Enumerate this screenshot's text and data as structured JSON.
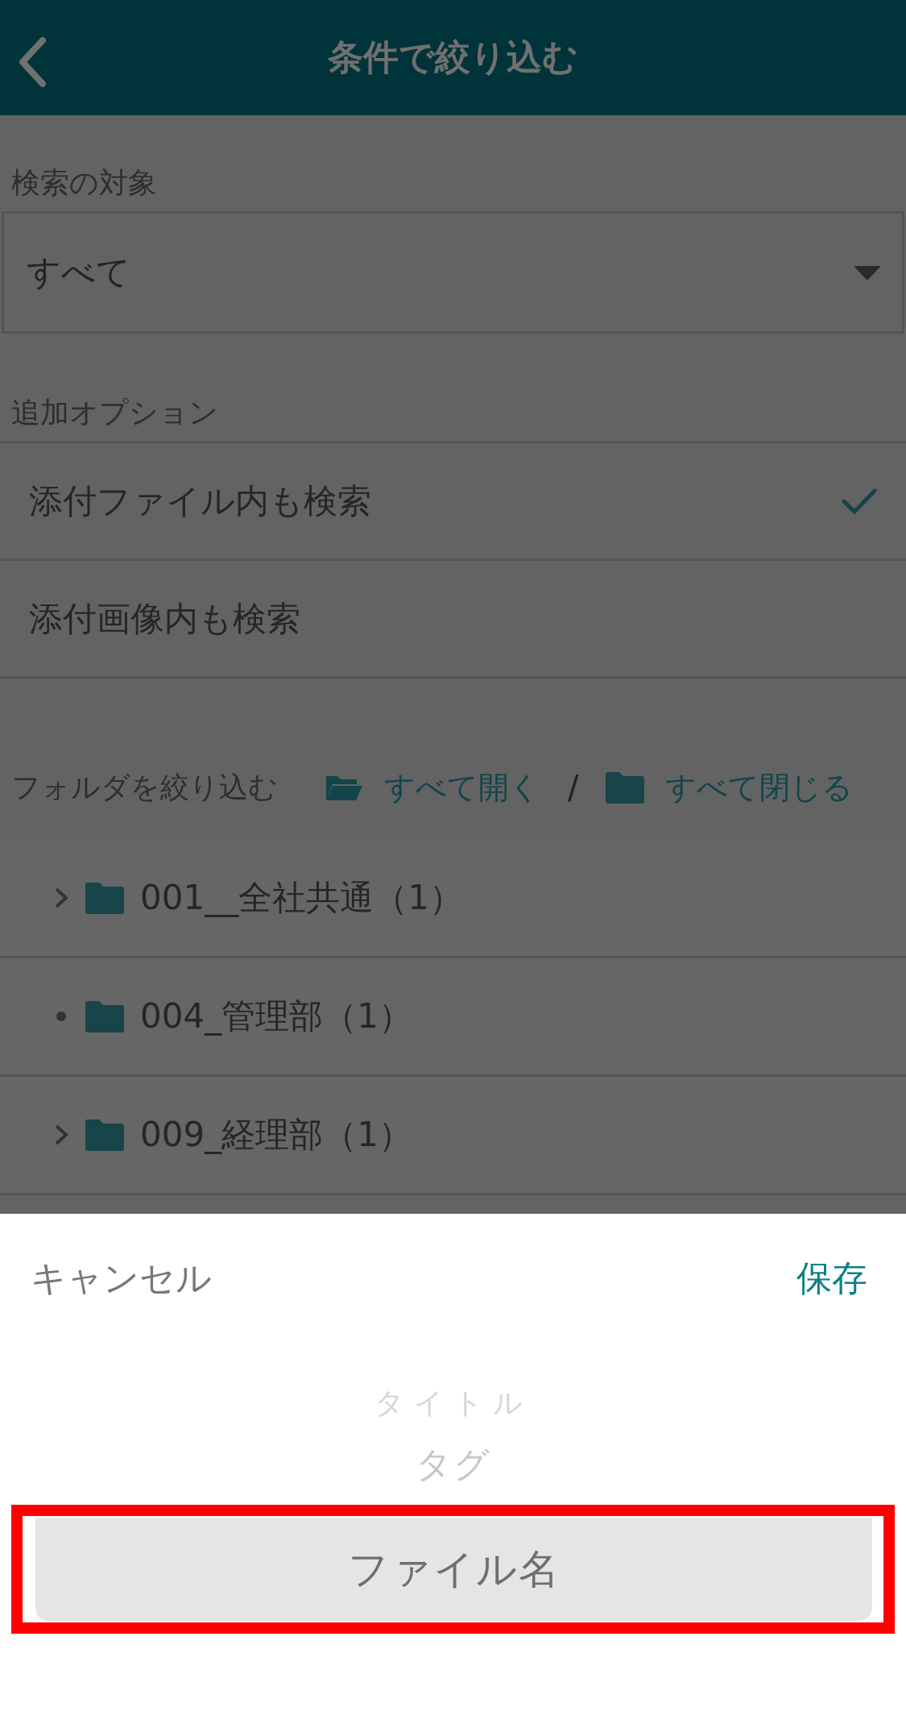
{
  "header": {
    "title": "条件で絞り込む"
  },
  "search_target": {
    "label": "検索の対象",
    "value": "すべて"
  },
  "additional_options": {
    "label": "追加オプション",
    "items": [
      {
        "label": "添付ファイル内も検索",
        "checked": true
      },
      {
        "label": "添付画像内も検索",
        "checked": false
      }
    ]
  },
  "folder_filter": {
    "label": "フォルダを絞り込む",
    "expand_all": "すべて開く",
    "separator": "/",
    "collapse_all": "すべて閉じる",
    "folders": [
      {
        "name": "001__全社共通（1）",
        "kind": "expandable"
      },
      {
        "name": "004_管理部（1）",
        "kind": "leaf"
      },
      {
        "name": "009_経理部（1）",
        "kind": "expandable"
      }
    ]
  },
  "picker": {
    "cancel": "キャンセル",
    "save": "保存",
    "options": [
      {
        "label": "タイトル",
        "selected": false,
        "kind": "far"
      },
      {
        "label": "タグ",
        "selected": false,
        "kind": "near"
      },
      {
        "label": "ファイル名",
        "selected": true,
        "kind": "center",
        "annotated": true
      }
    ]
  }
}
